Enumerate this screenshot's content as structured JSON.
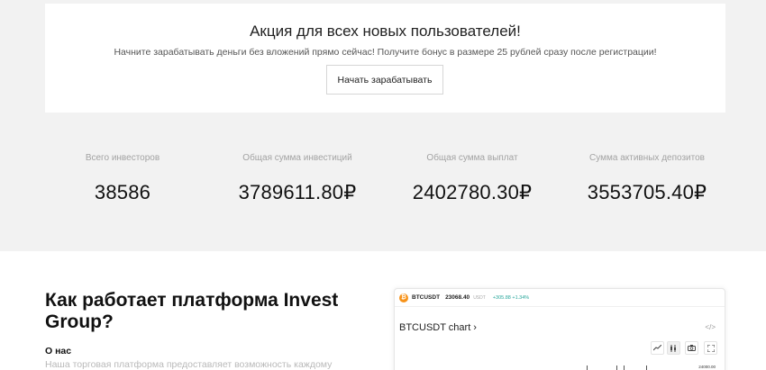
{
  "promo": {
    "title": "Акция для всех новых пользователей!",
    "subtitle": "Начните зарабатывать деньги без вложений прямо сейчас! Получите бонус в размере 25 рублей сразу после регистрации!",
    "button_label": "Начать зарабатывать"
  },
  "stats": [
    {
      "label": "Всего инвесторов",
      "value": "38586"
    },
    {
      "label": "Общая сумма инвестиций",
      "value": "3789611.80₽"
    },
    {
      "label": "Общая сумма выплат",
      "value": "2402780.30₽"
    },
    {
      "label": "Сумма активных депозитов",
      "value": "3553705.40₽"
    }
  ],
  "about": {
    "title": "Как работает платформа Invest Group?",
    "subtitle": "О нас",
    "text": "Наша торговая платформа предоставляет возможность каждому"
  },
  "widget": {
    "coin_glyph": "₿",
    "symbol": "BTCUSDT",
    "price": "23068.40",
    "unit": "USDT",
    "change": "+305.88  +1.34%",
    "chart_title": "BTCUSDT chart ›",
    "embed_icon": "</>",
    "tools": [
      "line-chart-icon",
      "candles-icon",
      "camera-icon",
      "fullscreen-icon"
    ],
    "price_label": "24000.00"
  },
  "colors": {
    "page_bg": "#f2f2f2",
    "panel_bg": "#ffffff",
    "muted_label": "#a3a3a3",
    "positive": "#26a69a",
    "btc_orange": "#f7931a"
  }
}
